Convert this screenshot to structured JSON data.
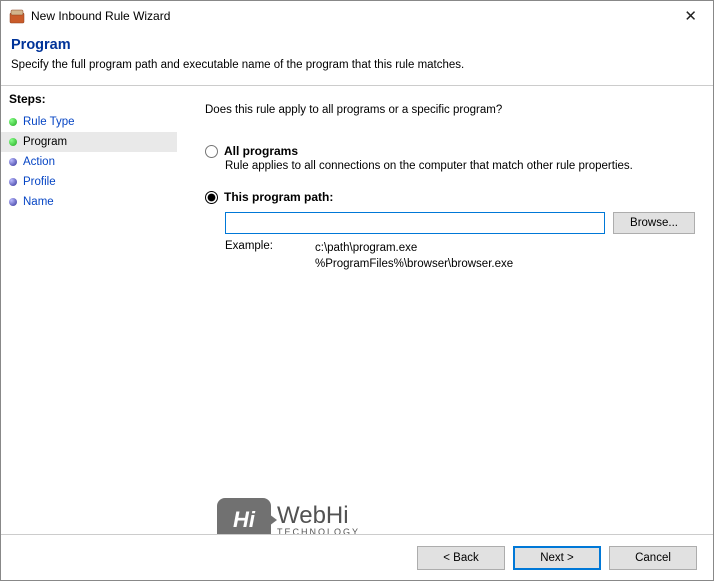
{
  "window": {
    "title": "New Inbound Rule Wizard"
  },
  "header": {
    "heading": "Program",
    "subtitle": "Specify the full program path and executable name of the program that this rule matches."
  },
  "sidebar": {
    "title": "Steps:",
    "items": [
      {
        "label": "Rule Type"
      },
      {
        "label": "Program"
      },
      {
        "label": "Action"
      },
      {
        "label": "Profile"
      },
      {
        "label": "Name"
      }
    ]
  },
  "content": {
    "question": "Does this rule apply to all programs or a specific program?",
    "option_all": {
      "label": "All programs",
      "desc": "Rule applies to all connections on the computer that match other rule properties."
    },
    "option_path": {
      "label": "This program path:",
      "input_value": "",
      "browse_label": "Browse...",
      "example_label": "Example:",
      "example_line1": "c:\\path\\program.exe",
      "example_line2": "%ProgramFiles%\\browser\\browser.exe"
    }
  },
  "watermark": {
    "box": "Hi",
    "line1": "WebHi",
    "line2": "TECHNOLOGY"
  },
  "footer": {
    "back": "< Back",
    "next": "Next >",
    "cancel": "Cancel"
  }
}
